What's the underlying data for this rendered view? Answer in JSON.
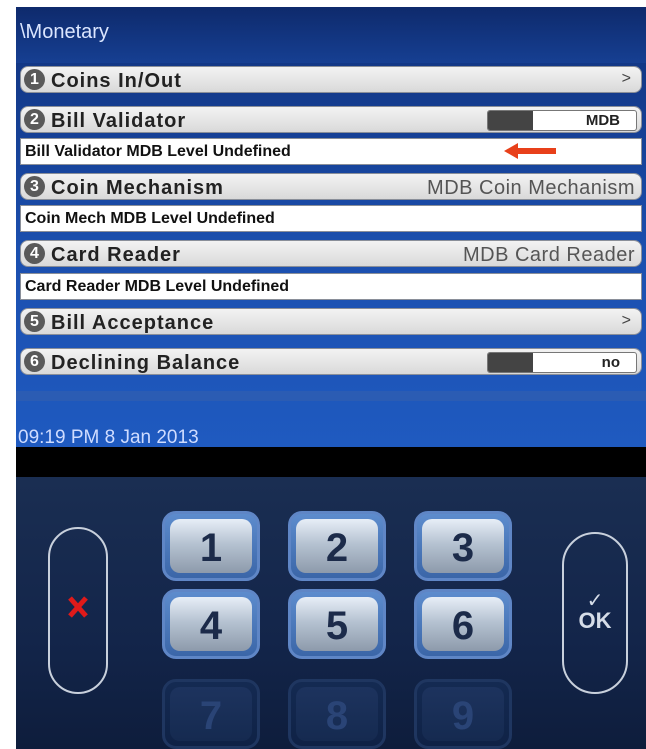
{
  "header": {
    "title": "\\Monetary"
  },
  "menu": [
    {
      "num": "1",
      "label": "Coins In/Out",
      "type": "arrow",
      "right": ">"
    },
    {
      "num": "2",
      "label": "Bill Validator",
      "type": "toggle",
      "value": "MDB"
    },
    {
      "num": "3",
      "label": "Coin Mechanism",
      "type": "value",
      "value": "MDB Coin Mechanism"
    },
    {
      "num": "4",
      "label": "Card Reader",
      "type": "value",
      "value": "MDB Card Reader"
    },
    {
      "num": "5",
      "label": "Bill Acceptance",
      "type": "arrow",
      "right": ">"
    },
    {
      "num": "6",
      "label": "Declining Balance",
      "type": "toggle",
      "value": "no"
    }
  ],
  "info": [
    "Bill Validator MDB Level Undefined",
    "Coin Mech MDB Level Undefined",
    "Card Reader MDB Level Undefined"
  ],
  "status": {
    "timestamp": "09:19 PM 8 Jan 2013"
  },
  "keypad": {
    "keys": [
      "1",
      "2",
      "3",
      "4",
      "5",
      "6",
      "7",
      "8",
      "9"
    ],
    "cancel": "X",
    "ok": "OK",
    "ok_check": "✓"
  },
  "colors": {
    "screen": "#1b4fae",
    "arrow": "#e8401a",
    "cancel": "#e01a1a"
  }
}
